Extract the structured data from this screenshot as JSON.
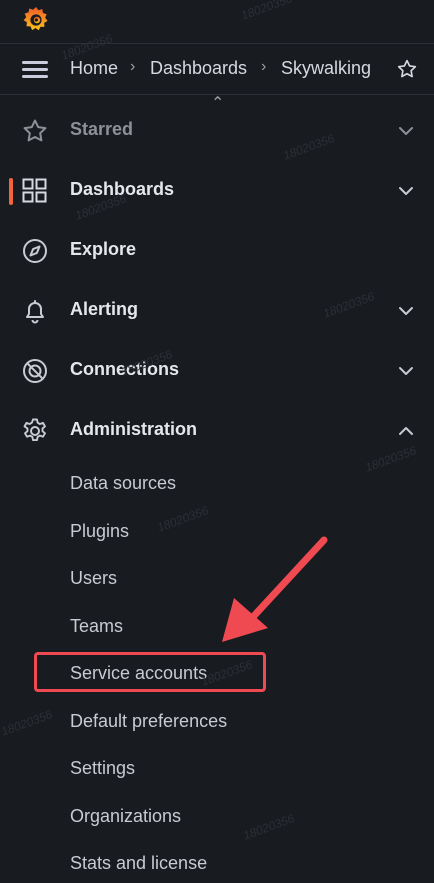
{
  "breadcrumb": {
    "items": [
      "Home",
      "Dashboards",
      "Skywalking"
    ],
    "separator": "›"
  },
  "nav": {
    "items": [
      {
        "label": "Starred",
        "icon": "star-icon",
        "expanded": false,
        "dim": true
      },
      {
        "label": "Dashboards",
        "icon": "dashboards-grid-icon",
        "expanded": false,
        "active": true
      },
      {
        "label": "Explore",
        "icon": "compass-icon"
      },
      {
        "label": "Alerting",
        "icon": "bell-icon",
        "expanded": false
      },
      {
        "label": "Connections",
        "icon": "connections-icon",
        "expanded": false
      },
      {
        "label": "Administration",
        "icon": "gear-icon",
        "expanded": true
      }
    ],
    "admin_items": [
      "Data sources",
      "Plugins",
      "Users",
      "Teams",
      "Service accounts",
      "Default preferences",
      "Settings",
      "Organizations",
      "Stats and license"
    ]
  },
  "annotation": {
    "highlighted_item": "Service accounts",
    "color": "#ef4a52"
  },
  "colors": {
    "background": "#181b1f",
    "active_accent": "#f2643a",
    "text": "#d8d9e0"
  },
  "watermark": "18020356"
}
